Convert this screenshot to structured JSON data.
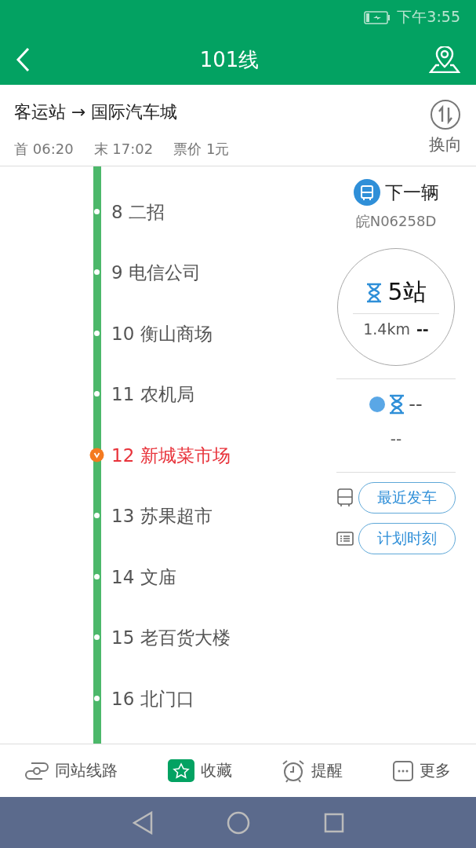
{
  "status_bar": {
    "time": "下午3:55"
  },
  "header": {
    "title": "101线"
  },
  "route": {
    "direction": "客运站 → 国际汽车城",
    "first": "首 06:20",
    "last": "末 17:02",
    "fare": "票价 1元",
    "reverse_label": "换向"
  },
  "stations": [
    {
      "name": "8 二招",
      "selected": false
    },
    {
      "name": "9 电信公司",
      "selected": false
    },
    {
      "name": "10 衡山商场",
      "selected": false
    },
    {
      "name": "11 农机局",
      "selected": false
    },
    {
      "name": "12 新城菜市场",
      "selected": true
    },
    {
      "name": "13 苏果超市",
      "selected": false
    },
    {
      "name": "14 文庙",
      "selected": false
    },
    {
      "name": "15 老百货大楼",
      "selected": false
    },
    {
      "name": "16 北门口",
      "selected": false
    }
  ],
  "next_bus": {
    "label": "下一辆",
    "plate": "皖N06258D",
    "stops": "5站",
    "distance": "1.4km",
    "eta": "--",
    "second_eta": "--",
    "second_distance": "--"
  },
  "actions": [
    {
      "kind": "bus",
      "label": "最近发车"
    },
    {
      "kind": "list",
      "label": "计划时刻"
    }
  ],
  "bottom_tabs": [
    {
      "kind": "link",
      "label": "同站线路",
      "on": false
    },
    {
      "kind": "star",
      "label": "收藏",
      "on": true
    },
    {
      "kind": "alarm",
      "label": "提醒",
      "on": false
    },
    {
      "kind": "more",
      "label": "更多",
      "on": false
    }
  ]
}
